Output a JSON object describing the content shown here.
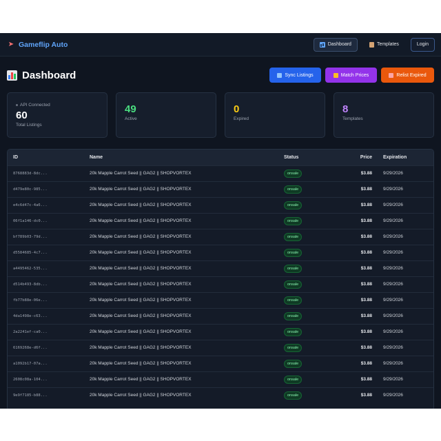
{
  "nav": {
    "brand": "Gameflip Auto",
    "brand_icon": "rocket-icon",
    "links": [
      {
        "label": "Dashboard",
        "icon": "dashboard-icon",
        "active": true
      },
      {
        "label": "Templates",
        "icon": "templates-icon",
        "active": false
      }
    ],
    "login_label": "Login"
  },
  "header": {
    "title": "Dashboard",
    "title_icon": "bar-chart-icon",
    "sync_label": "Sync Listings",
    "match_label": "Match Prices",
    "relist_label": "Relist Expired"
  },
  "stats": {
    "api_status": "API Connected",
    "total": {
      "value": "60",
      "label": "Total Listings"
    },
    "active": {
      "value": "49",
      "label": "Active"
    },
    "expired": {
      "value": "0",
      "label": "Expired"
    },
    "templates": {
      "value": "8",
      "label": "Templates"
    }
  },
  "colors": {
    "accent": "#60a5fa",
    "sync": "#2563eb",
    "match": "#9333ea",
    "relist": "#ea580c",
    "active": "#4ade80",
    "expired": "#facc15",
    "templates": "#c084fc"
  },
  "table": {
    "headers": {
      "id": "ID",
      "name": "Name",
      "status": "Status",
      "price": "Price",
      "expiration": "Expiration"
    },
    "rows": [
      {
        "id": "8768883d-8dc...",
        "name": "20k Mapple Carrot Seed || GAG2 || SHOPVORTEX",
        "status": "onsale",
        "price": "$3.88",
        "expiration": "9/29/2026"
      },
      {
        "id": "d479e80c-985...",
        "name": "20k Mapple Carrot Seed || GAG2 || SHOPVORTEX",
        "status": "onsale",
        "price": "$3.88",
        "expiration": "9/29/2026"
      },
      {
        "id": "e4c6d47c-4a6...",
        "name": "20k Mapple Carrot Seed || GAG2 || SHOPVORTEX",
        "status": "onsale",
        "price": "$3.88",
        "expiration": "9/29/2026"
      },
      {
        "id": "06f1a146-dc0...",
        "name": "20k Mapple Carrot Seed || GAG2 || SHOPVORTEX",
        "status": "onsale",
        "price": "$3.88",
        "expiration": "9/29/2026"
      },
      {
        "id": "bf789b03-79d...",
        "name": "20k Mapple Carrot Seed || GAG2 || SHOPVORTEX",
        "status": "onsale",
        "price": "$3.88",
        "expiration": "9/29/2026"
      },
      {
        "id": "d5584685-4c7...",
        "name": "20k Mapple Carrot Seed || GAG2 || SHOPVORTEX",
        "status": "onsale",
        "price": "$3.88",
        "expiration": "9/29/2026"
      },
      {
        "id": "a4495462-535...",
        "name": "20k Mapple Carrot Seed || GAG2 || SHOPVORTEX",
        "status": "onsale",
        "price": "$3.88",
        "expiration": "9/29/2026"
      },
      {
        "id": "d514b493-8db...",
        "name": "20k Mapple Carrot Seed || GAG2 || SHOPVORTEX",
        "status": "onsale",
        "price": "$3.88",
        "expiration": "9/29/2026"
      },
      {
        "id": "fb77b88e-06e...",
        "name": "20k Mapple Carrot Seed || GAG2 || SHOPVORTEX",
        "status": "onsale",
        "price": "$3.88",
        "expiration": "9/29/2026"
      },
      {
        "id": "4da1498e-c63...",
        "name": "20k Mapple Carrot Seed || GAG2 || SHOPVORTEX",
        "status": "onsale",
        "price": "$3.88",
        "expiration": "9/29/2026"
      },
      {
        "id": "2a2241ef-ca0...",
        "name": "20k Mapple Carrot Seed || GAG2 || SHOPVORTEX",
        "status": "onsale",
        "price": "$3.88",
        "expiration": "9/29/2026"
      },
      {
        "id": "6169268e-d6f...",
        "name": "20k Mapple Carrot Seed || GAG2 || SHOPVORTEX",
        "status": "onsale",
        "price": "$3.88",
        "expiration": "9/29/2026"
      },
      {
        "id": "a1092b17-07a...",
        "name": "20k Mapple Carrot Seed || GAG2 || SHOPVORTEX",
        "status": "onsale",
        "price": "$3.88",
        "expiration": "9/29/2026"
      },
      {
        "id": "2608c08a-104...",
        "name": "20k Mapple Carrot Seed || GAG2 || SHOPVORTEX",
        "status": "onsale",
        "price": "$3.88",
        "expiration": "9/29/2026"
      },
      {
        "id": "9e9f7185-b88...",
        "name": "20k Mapple Carrot Seed || GAG2 || SHOPVORTEX",
        "status": "onsale",
        "price": "$3.88",
        "expiration": "9/29/2026"
      }
    ]
  }
}
